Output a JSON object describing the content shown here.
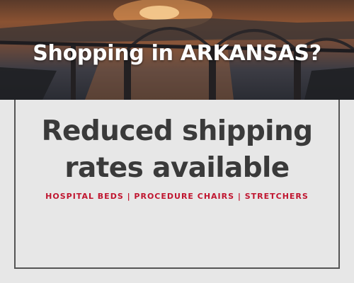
{
  "hero": {
    "title": "Shopping in ARKANSAS?"
  },
  "offer": {
    "line1": "Reduced shipping",
    "line2": "rates available"
  },
  "categories": "HOSPITAL BEDS | PROCEDURE CHAIRS | STRETCHERS",
  "colors": {
    "accent": "#c0152f",
    "headline": "#3a3a3a",
    "background": "#e7e7e7",
    "border": "#555555"
  }
}
